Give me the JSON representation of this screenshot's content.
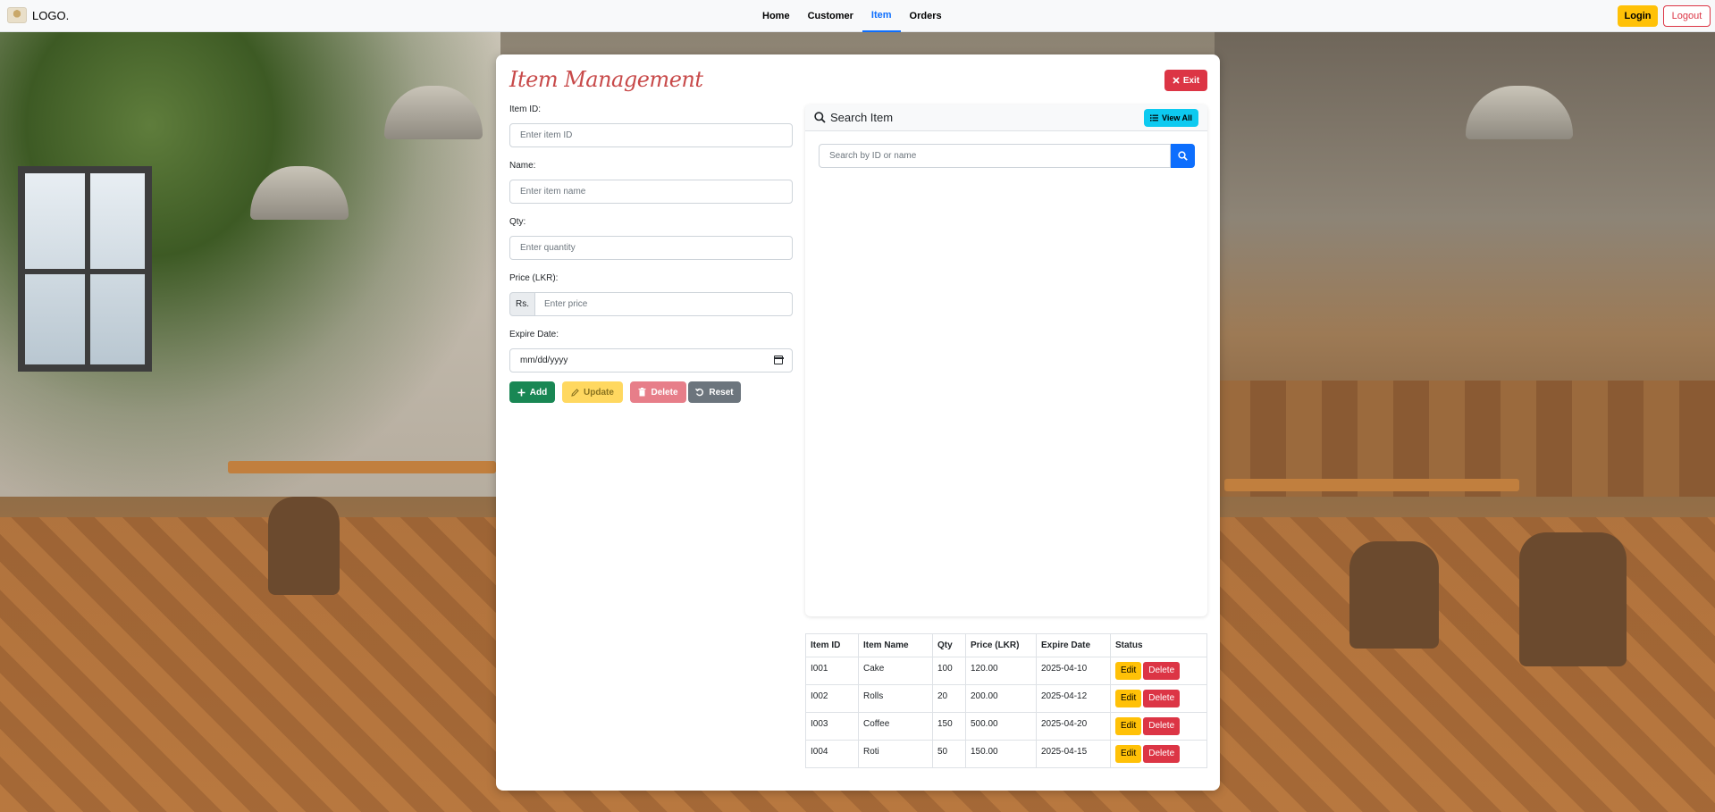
{
  "navbar": {
    "brand": "LOGO.",
    "links": [
      "Home",
      "Customer",
      "Item",
      "Orders"
    ],
    "active": "Item",
    "login": "Login",
    "logout": "Logout"
  },
  "page": {
    "title": "Item Management",
    "exit_label": "Exit"
  },
  "form": {
    "item_id_label": "Item ID:",
    "item_id_placeholder": "Enter item ID",
    "name_label": "Name:",
    "name_placeholder": "Enter item name",
    "qty_label": "Qty:",
    "qty_placeholder": "Enter quantity",
    "price_label": "Price (LKR):",
    "price_prefix": "Rs.",
    "price_placeholder": "Enter price",
    "expire_label": "Expire Date:",
    "expire_value": "mm/dd/yyyy",
    "buttons": {
      "add": "Add",
      "update": "Update",
      "delete": "Delete",
      "reset": "Reset"
    }
  },
  "search": {
    "title": "Search Item",
    "view_all": "View All",
    "placeholder": "Search by ID or name"
  },
  "table": {
    "headers": [
      "Item ID",
      "Item Name",
      "Qty",
      "Price (LKR)",
      "Expire Date",
      "Status"
    ],
    "rows": [
      {
        "id": "I001",
        "name": "Cake",
        "qty": "100",
        "price": "120.00",
        "expire": "2025-04-10"
      },
      {
        "id": "I002",
        "name": "Rolls",
        "qty": "20",
        "price": "200.00",
        "expire": "2025-04-12"
      },
      {
        "id": "I003",
        "name": "Coffee",
        "qty": "150",
        "price": "500.00",
        "expire": "2025-04-20"
      },
      {
        "id": "I004",
        "name": "Roti",
        "qty": "50",
        "price": "150.00",
        "expire": "2025-04-15"
      }
    ],
    "edit_label": "Edit",
    "delete_label": "Delete"
  },
  "colors": {
    "primary": "#0d6efd",
    "success": "#198754",
    "warning": "#ffc107",
    "danger": "#dc3545",
    "info": "#0dcaf0",
    "secondary": "#6c757d",
    "title": "#c84a4a"
  },
  "icons": {
    "exit": "x-icon",
    "add": "plus-icon",
    "update": "pencil-icon",
    "delete": "trash-icon",
    "reset": "undo-icon",
    "search": "search-icon",
    "view_all": "list-icon"
  }
}
